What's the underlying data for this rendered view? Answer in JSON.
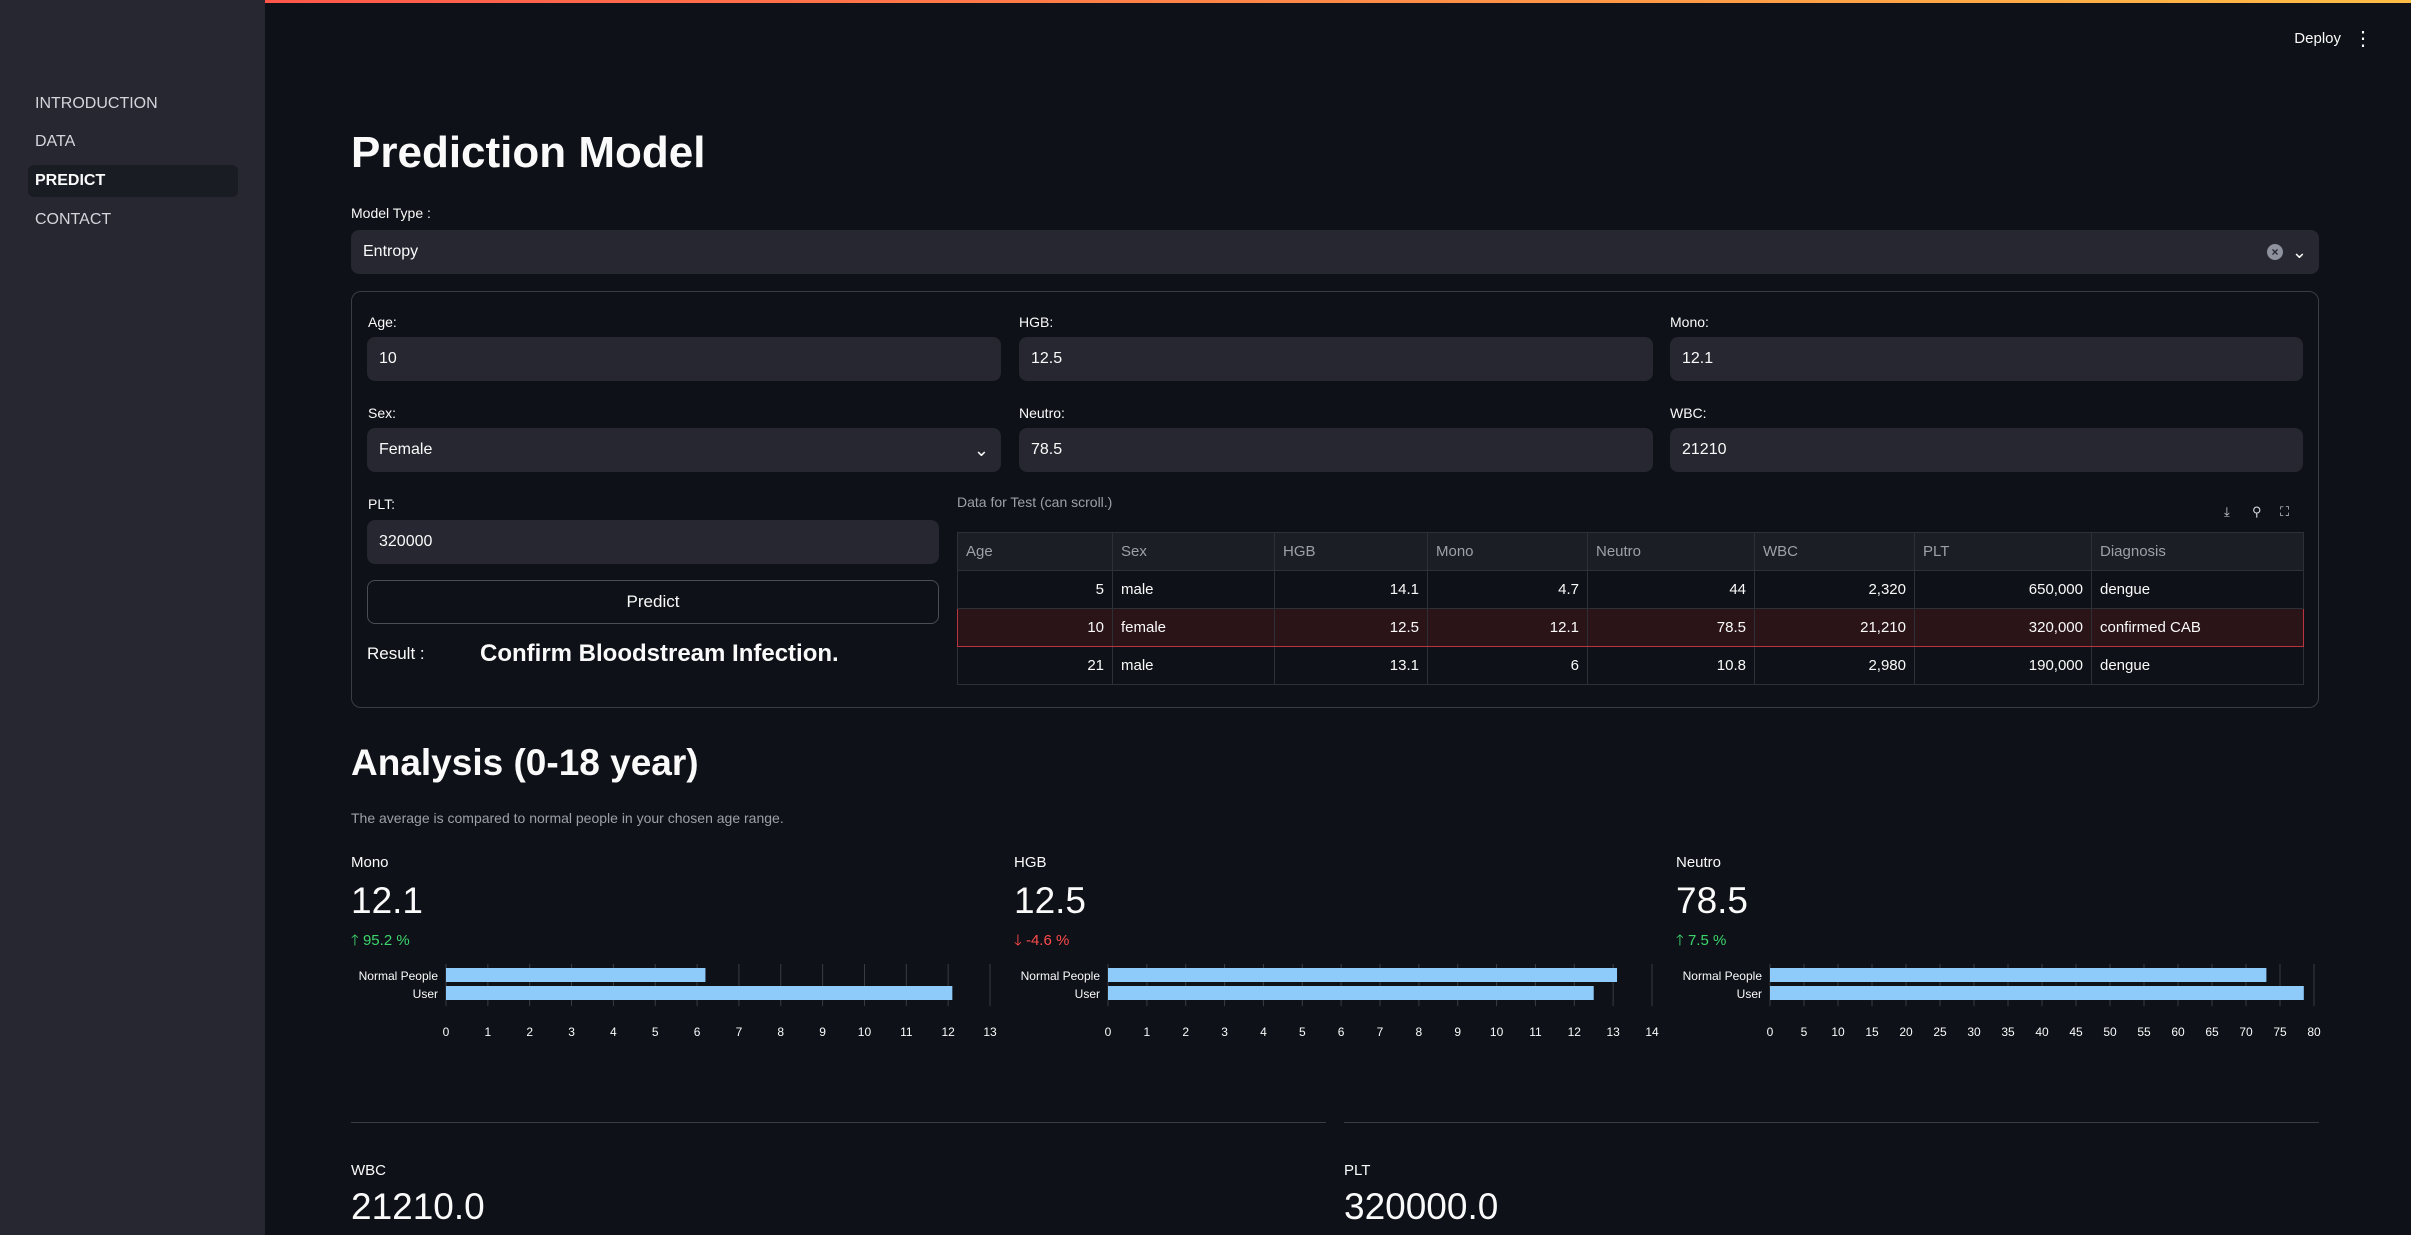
{
  "header": {
    "deploy_label": "Deploy",
    "menu_icon": "⋮"
  },
  "sidebar": {
    "items": [
      {
        "label": "INTRODUCTION"
      },
      {
        "label": "DATA"
      },
      {
        "label": "PREDICT",
        "active": true
      },
      {
        "label": "CONTACT"
      }
    ]
  },
  "main": {
    "title": "Prediction Model",
    "model_type": {
      "label": "Model Type :",
      "value": "Entropy"
    },
    "form": {
      "age": {
        "label": "Age:",
        "value": "10"
      },
      "hgb": {
        "label": "HGB:",
        "value": "12.5"
      },
      "mono": {
        "label": "Mono:",
        "value": "12.1"
      },
      "sex": {
        "label": "Sex:",
        "value": "Female"
      },
      "neutro": {
        "label": "Neutro:",
        "value": "78.5"
      },
      "wbc": {
        "label": "WBC:",
        "value": "21210"
      },
      "plt": {
        "label": "PLT:",
        "value": "320000"
      },
      "predict_label": "Predict",
      "result_label": "Result :",
      "result_value": "Confirm Bloodstream Infection."
    },
    "test_table": {
      "caption": "Data for Test (can scroll.)",
      "columns": [
        "Age",
        "Sex",
        "HGB",
        "Mono",
        "Neutro",
        "WBC",
        "PLT",
        "Diagnosis"
      ],
      "rows": [
        [
          "5",
          "male",
          "14.1",
          "4.7",
          "44",
          "2,320",
          "650,000",
          "dengue"
        ],
        [
          "10",
          "female",
          "12.5",
          "12.1",
          "78.5",
          "21,210",
          "320,000",
          "confirmed CAB"
        ],
        [
          "21",
          "male",
          "13.1",
          "6",
          "10.8",
          "2,980",
          "190,000",
          "dengue"
        ]
      ]
    },
    "analysis": {
      "title": "Analysis (0-18 year)",
      "caption": "The average is compared to normal people in your chosen age range.",
      "metrics": [
        {
          "label": "Mono",
          "value": "12.1",
          "delta": "95.2 %",
          "direction": "up"
        },
        {
          "label": "HGB",
          "value": "12.5",
          "delta": "-4.6 %",
          "direction": "down"
        },
        {
          "label": "Neutro",
          "value": "78.5",
          "delta": "7.5 %",
          "direction": "up"
        }
      ],
      "bottom_metrics": [
        {
          "label": "WBC",
          "value": "21210.0"
        },
        {
          "label": "PLT",
          "value": "320000.0"
        }
      ]
    }
  },
  "chart_data": [
    {
      "type": "bar",
      "orientation": "horizontal",
      "categories": [
        "Normal People",
        "User"
      ],
      "values": [
        6.2,
        12.1
      ],
      "xlim": [
        0,
        13
      ],
      "ticks": [
        0,
        1,
        2,
        3,
        4,
        5,
        6,
        7,
        8,
        9,
        10,
        11,
        12,
        13
      ],
      "bar_color": "#8ecbfb",
      "grid": true
    },
    {
      "type": "bar",
      "orientation": "horizontal",
      "categories": [
        "Normal People",
        "User"
      ],
      "values": [
        13.1,
        12.5
      ],
      "xlim": [
        0,
        14
      ],
      "ticks": [
        0,
        1,
        2,
        3,
        4,
        5,
        6,
        7,
        8,
        9,
        10,
        11,
        12,
        13,
        14
      ],
      "bar_color": "#8ecbfb",
      "grid": true
    },
    {
      "type": "bar",
      "orientation": "horizontal",
      "categories": [
        "Normal People",
        "User"
      ],
      "values": [
        73,
        78.5
      ],
      "xlim": [
        0,
        80
      ],
      "ticks": [
        0,
        5,
        10,
        15,
        20,
        25,
        30,
        35,
        40,
        45,
        50,
        55,
        60,
        65,
        70,
        75,
        80
      ],
      "bar_color": "#8ecbfb",
      "grid": true
    }
  ]
}
